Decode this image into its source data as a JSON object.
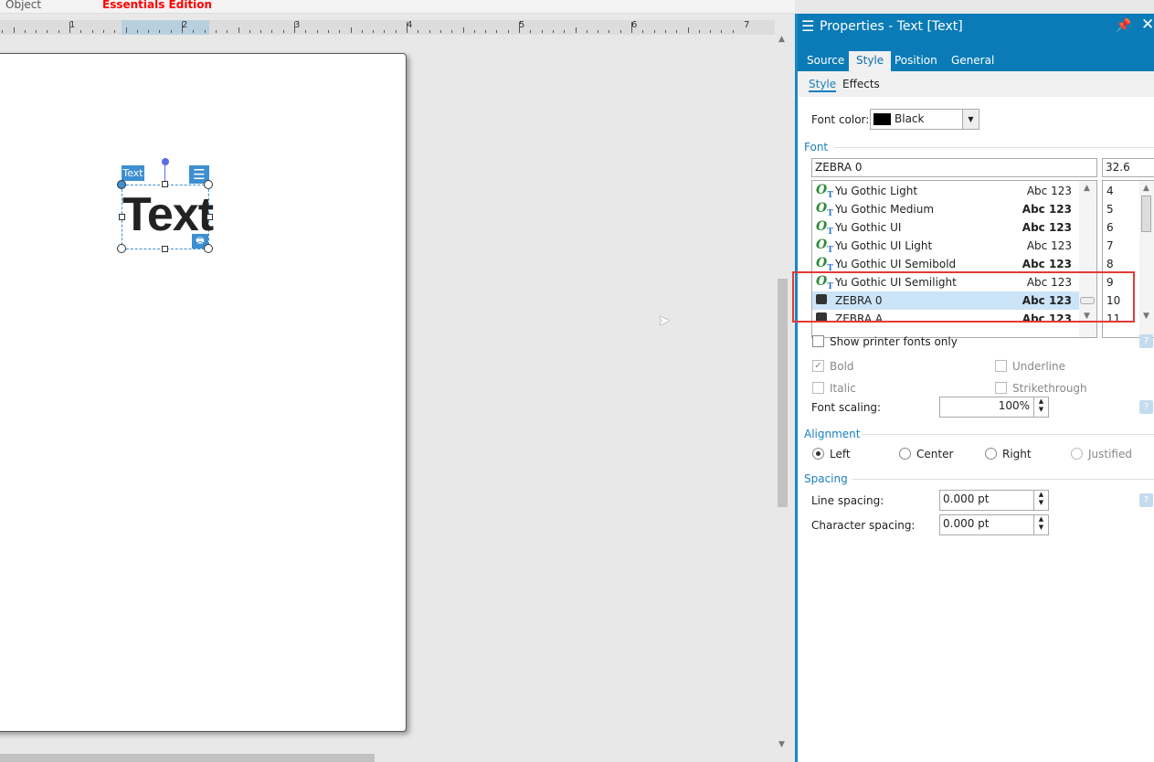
{
  "topbar": {
    "tab_object": "Object",
    "edition": "Essentials Edition"
  },
  "ruler": {
    "labels": [
      "1",
      "2",
      "3",
      "4",
      "5",
      "6",
      "7"
    ]
  },
  "canvas": {
    "object_tag": "Text",
    "object_text": "Text"
  },
  "panel": {
    "title": "Properties - Text [Text]",
    "tabs": [
      "Source",
      "Style",
      "Position",
      "General"
    ],
    "active_tab": "Style",
    "subtabs": [
      "Style",
      "Effects"
    ],
    "font_color_label": "Font color:",
    "font_color_value": "Black",
    "font_section": "Font",
    "font_name": "ZEBRA 0",
    "font_size": "32.6",
    "fonts": [
      {
        "name": "Yu Gothic Light",
        "preview": "Abc 123",
        "type": "opentype"
      },
      {
        "name": "Yu Gothic Medium",
        "preview": "Abc 123",
        "type": "opentype"
      },
      {
        "name": "Yu Gothic UI",
        "preview": "Abc 123",
        "type": "opentype"
      },
      {
        "name": "Yu Gothic UI Light",
        "preview": "Abc 123",
        "type": "opentype"
      },
      {
        "name": "Yu Gothic UI Semibold",
        "preview": "Abc 123",
        "type": "opentype"
      },
      {
        "name": "Yu Gothic UI Semilight",
        "preview": "Abc 123",
        "type": "opentype"
      },
      {
        "name": "ZEBRA 0",
        "preview": "Abc 123",
        "type": "printer",
        "selected": true
      },
      {
        "name": "ZEBRA A",
        "preview": "Abc 123",
        "type": "printer"
      }
    ],
    "sizes": [
      "4",
      "5",
      "6",
      "7",
      "8",
      "9",
      "10",
      "11"
    ],
    "show_printer_fonts": "Show printer fonts only",
    "bold": "Bold",
    "underline": "Underline",
    "italic": "Italic",
    "strikethrough": "Strikethrough",
    "bold_checked": true,
    "font_scaling_label": "Font scaling:",
    "font_scaling": "100%",
    "alignment_section": "Alignment",
    "align": [
      "Left",
      "Center",
      "Right",
      "Justified"
    ],
    "align_selected": "Left",
    "spacing_section": "Spacing",
    "line_spacing_label": "Line spacing:",
    "line_spacing": "0.000 pt",
    "char_spacing_label": "Character spacing:",
    "char_spacing": "0.000 pt",
    "help": "?"
  },
  "colors": {
    "accent": "#0a7bb6",
    "highlight": "#e53935",
    "edition": "#ff0000"
  }
}
